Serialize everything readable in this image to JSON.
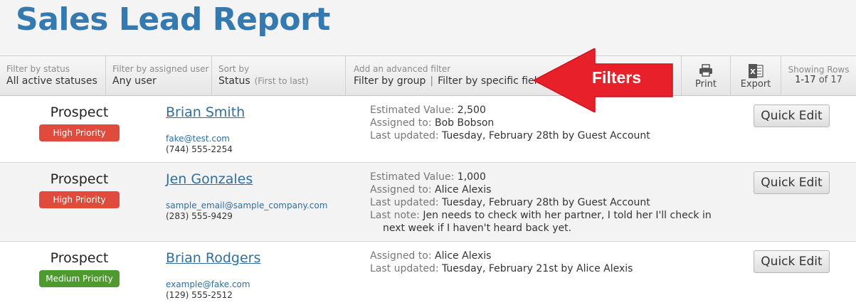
{
  "page": {
    "title": "Sales Lead Report"
  },
  "toolbar": {
    "status_filter": {
      "label": "Filter by status",
      "value": "All active statuses"
    },
    "user_filter": {
      "label": "Filter by assigned user",
      "value": "Any user"
    },
    "sort": {
      "label": "Sort by",
      "value": "Status",
      "hint": "(First to last)"
    },
    "advanced": {
      "label": "Add an advanced filter",
      "group_link": "Filter by group",
      "separator": "|",
      "field_link": "Filter by specific field"
    },
    "print_label": "Print",
    "export_label": "Export",
    "showing": {
      "label": "Showing Rows",
      "range": "1-17",
      "of_text": "of 17"
    }
  },
  "annotation": {
    "text": "Filters",
    "color": "#e8202a"
  },
  "rows": [
    {
      "status": "Prospect",
      "priority": "High Priority",
      "priority_color": "#e04b3d",
      "name": "Brian Smith",
      "email": "fake@test.com",
      "phone": "(744) 555-2254",
      "estimated_label": "Estimated Value:",
      "estimated_value": "2,500",
      "assigned_label": "Assigned to:",
      "assigned_value": "Bob Bobson",
      "updated_label": "Last updated:",
      "updated_value": "Tuesday, February 28th by Guest Account",
      "quick_edit": "Quick Edit"
    },
    {
      "status": "Prospect",
      "priority": "High Priority",
      "priority_color": "#e04b3d",
      "name": "Jen Gonzales",
      "email": "sample_email@sample_company.com",
      "phone": "(283) 555-9429",
      "estimated_label": "Estimated Value:",
      "estimated_value": "1,000",
      "assigned_label": "Assigned to:",
      "assigned_value": "Alice Alexis",
      "updated_label": "Last updated:",
      "updated_value": "Tuesday, February 28th by Guest Account",
      "note_label": "Last note:",
      "note_value": "Jen needs to check with her partner, I told her I'll check in next week if I haven't heard back yet.",
      "quick_edit": "Quick Edit"
    },
    {
      "status": "Prospect",
      "priority": "Medium Priority",
      "priority_color": "#4e9a2e",
      "name": "Brian Rodgers",
      "email": "example@fake.com",
      "phone": "(129) 555-2512",
      "assigned_label": "Assigned to:",
      "assigned_value": "Alice Alexis",
      "updated_label": "Last updated:",
      "updated_value": "Tuesday, February 21st by Alice Alexis",
      "quick_edit": "Quick Edit"
    }
  ]
}
